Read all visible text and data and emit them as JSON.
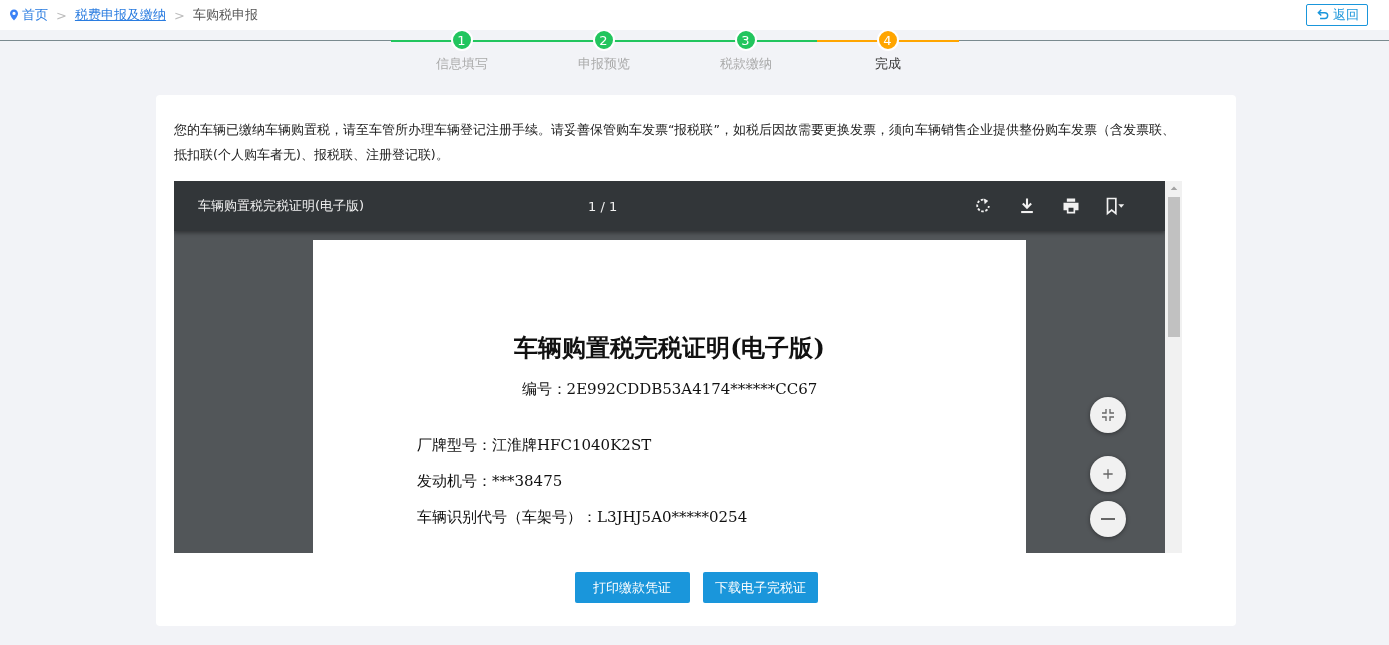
{
  "breadcrumb": [
    {
      "label": "首页",
      "kind": "home"
    },
    {
      "label": ">",
      "kind": "separator"
    },
    {
      "label": "税费申报及缴纳",
      "kind": "link"
    },
    {
      "label": ">",
      "kind": "separator"
    },
    {
      "label": "车购税申报",
      "kind": "current"
    }
  ],
  "back_button": {
    "label": "返回"
  },
  "steps": [
    {
      "number": "1",
      "label": "信息填写",
      "completed": true
    },
    {
      "number": "2",
      "label": "申报预览",
      "completed": true
    },
    {
      "number": "3",
      "label": "税款缴纳",
      "completed": true
    },
    {
      "number": "4",
      "label": "完成",
      "completed": false
    }
  ],
  "notice": "您的车辆已缴纳车辆购置税，请至车管所办理车辆登记注册手续。请妥善保管购车发票“报税联”，如税后因故需要更换发票，须向车辆销售企业提供整份购车发票（含发票联、抵扣联(个人购车者无)、报税联、注册登记联)。",
  "viewer": {
    "title": "车辆购置税完税证明(电子版)",
    "page_count": "1 / 1",
    "document": {
      "title": "车辆购置税完税证明(电子版)",
      "number": "编号：2E992CDDB53A4174******CC67",
      "fields": [
        "厂牌型号：江淮牌HFC1040K2ST",
        "发动机号：***38475",
        "车辆识别代号（车架号）：L3JHJ5A0*****0254"
      ]
    }
  },
  "buttons": [
    "打印缴款凭证",
    "下载电子完税证"
  ]
}
